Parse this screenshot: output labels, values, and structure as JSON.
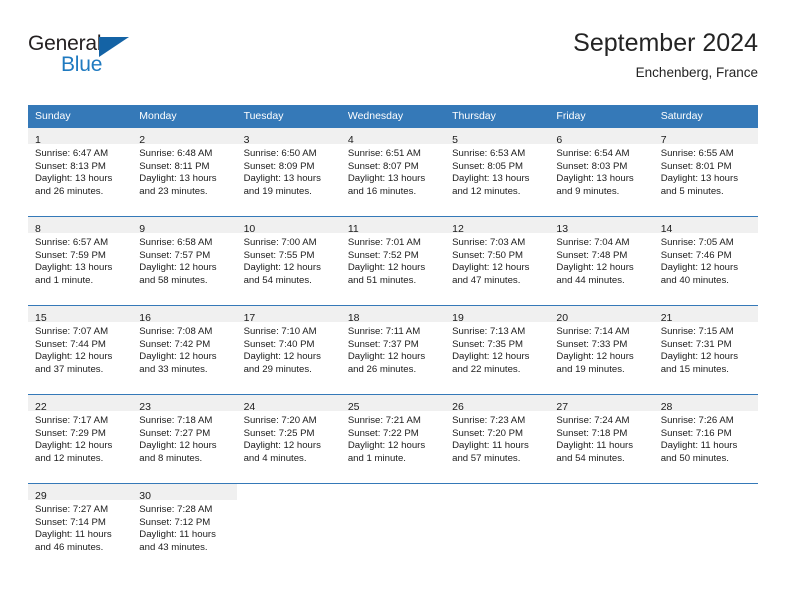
{
  "brand": {
    "name_part1": "General",
    "name_part2": "Blue",
    "triangle_color": "#1463a5",
    "blue_color": "#1f7ac0"
  },
  "header": {
    "title": "September 2024",
    "subtitle": "Enchenberg, France"
  },
  "theme": {
    "header_bg": "#3579b8",
    "daynum_band": "#f0f0f0",
    "row_border": "#3579b8"
  },
  "weekday_headers": [
    "Sunday",
    "Monday",
    "Tuesday",
    "Wednesday",
    "Thursday",
    "Friday",
    "Saturday"
  ],
  "weeks": [
    [
      {
        "day": "1",
        "sunrise": "Sunrise: 6:47 AM",
        "sunset": "Sunset: 8:13 PM",
        "daylight": "Daylight: 13 hours and 26 minutes."
      },
      {
        "day": "2",
        "sunrise": "Sunrise: 6:48 AM",
        "sunset": "Sunset: 8:11 PM",
        "daylight": "Daylight: 13 hours and 23 minutes."
      },
      {
        "day": "3",
        "sunrise": "Sunrise: 6:50 AM",
        "sunset": "Sunset: 8:09 PM",
        "daylight": "Daylight: 13 hours and 19 minutes."
      },
      {
        "day": "4",
        "sunrise": "Sunrise: 6:51 AM",
        "sunset": "Sunset: 8:07 PM",
        "daylight": "Daylight: 13 hours and 16 minutes."
      },
      {
        "day": "5",
        "sunrise": "Sunrise: 6:53 AM",
        "sunset": "Sunset: 8:05 PM",
        "daylight": "Daylight: 13 hours and 12 minutes."
      },
      {
        "day": "6",
        "sunrise": "Sunrise: 6:54 AM",
        "sunset": "Sunset: 8:03 PM",
        "daylight": "Daylight: 13 hours and 9 minutes."
      },
      {
        "day": "7",
        "sunrise": "Sunrise: 6:55 AM",
        "sunset": "Sunset: 8:01 PM",
        "daylight": "Daylight: 13 hours and 5 minutes."
      }
    ],
    [
      {
        "day": "8",
        "sunrise": "Sunrise: 6:57 AM",
        "sunset": "Sunset: 7:59 PM",
        "daylight": "Daylight: 13 hours and 1 minute."
      },
      {
        "day": "9",
        "sunrise": "Sunrise: 6:58 AM",
        "sunset": "Sunset: 7:57 PM",
        "daylight": "Daylight: 12 hours and 58 minutes."
      },
      {
        "day": "10",
        "sunrise": "Sunrise: 7:00 AM",
        "sunset": "Sunset: 7:55 PM",
        "daylight": "Daylight: 12 hours and 54 minutes."
      },
      {
        "day": "11",
        "sunrise": "Sunrise: 7:01 AM",
        "sunset": "Sunset: 7:52 PM",
        "daylight": "Daylight: 12 hours and 51 minutes."
      },
      {
        "day": "12",
        "sunrise": "Sunrise: 7:03 AM",
        "sunset": "Sunset: 7:50 PM",
        "daylight": "Daylight: 12 hours and 47 minutes."
      },
      {
        "day": "13",
        "sunrise": "Sunrise: 7:04 AM",
        "sunset": "Sunset: 7:48 PM",
        "daylight": "Daylight: 12 hours and 44 minutes."
      },
      {
        "day": "14",
        "sunrise": "Sunrise: 7:05 AM",
        "sunset": "Sunset: 7:46 PM",
        "daylight": "Daylight: 12 hours and 40 minutes."
      }
    ],
    [
      {
        "day": "15",
        "sunrise": "Sunrise: 7:07 AM",
        "sunset": "Sunset: 7:44 PM",
        "daylight": "Daylight: 12 hours and 37 minutes."
      },
      {
        "day": "16",
        "sunrise": "Sunrise: 7:08 AM",
        "sunset": "Sunset: 7:42 PM",
        "daylight": "Daylight: 12 hours and 33 minutes."
      },
      {
        "day": "17",
        "sunrise": "Sunrise: 7:10 AM",
        "sunset": "Sunset: 7:40 PM",
        "daylight": "Daylight: 12 hours and 29 minutes."
      },
      {
        "day": "18",
        "sunrise": "Sunrise: 7:11 AM",
        "sunset": "Sunset: 7:37 PM",
        "daylight": "Daylight: 12 hours and 26 minutes."
      },
      {
        "day": "19",
        "sunrise": "Sunrise: 7:13 AM",
        "sunset": "Sunset: 7:35 PM",
        "daylight": "Daylight: 12 hours and 22 minutes."
      },
      {
        "day": "20",
        "sunrise": "Sunrise: 7:14 AM",
        "sunset": "Sunset: 7:33 PM",
        "daylight": "Daylight: 12 hours and 19 minutes."
      },
      {
        "day": "21",
        "sunrise": "Sunrise: 7:15 AM",
        "sunset": "Sunset: 7:31 PM",
        "daylight": "Daylight: 12 hours and 15 minutes."
      }
    ],
    [
      {
        "day": "22",
        "sunrise": "Sunrise: 7:17 AM",
        "sunset": "Sunset: 7:29 PM",
        "daylight": "Daylight: 12 hours and 12 minutes."
      },
      {
        "day": "23",
        "sunrise": "Sunrise: 7:18 AM",
        "sunset": "Sunset: 7:27 PM",
        "daylight": "Daylight: 12 hours and 8 minutes."
      },
      {
        "day": "24",
        "sunrise": "Sunrise: 7:20 AM",
        "sunset": "Sunset: 7:25 PM",
        "daylight": "Daylight: 12 hours and 4 minutes."
      },
      {
        "day": "25",
        "sunrise": "Sunrise: 7:21 AM",
        "sunset": "Sunset: 7:22 PM",
        "daylight": "Daylight: 12 hours and 1 minute."
      },
      {
        "day": "26",
        "sunrise": "Sunrise: 7:23 AM",
        "sunset": "Sunset: 7:20 PM",
        "daylight": "Daylight: 11 hours and 57 minutes."
      },
      {
        "day": "27",
        "sunrise": "Sunrise: 7:24 AM",
        "sunset": "Sunset: 7:18 PM",
        "daylight": "Daylight: 11 hours and 54 minutes."
      },
      {
        "day": "28",
        "sunrise": "Sunrise: 7:26 AM",
        "sunset": "Sunset: 7:16 PM",
        "daylight": "Daylight: 11 hours and 50 minutes."
      }
    ],
    [
      {
        "day": "29",
        "sunrise": "Sunrise: 7:27 AM",
        "sunset": "Sunset: 7:14 PM",
        "daylight": "Daylight: 11 hours and 46 minutes."
      },
      {
        "day": "30",
        "sunrise": "Sunrise: 7:28 AM",
        "sunset": "Sunset: 7:12 PM",
        "daylight": "Daylight: 11 hours and 43 minutes."
      },
      {
        "day": "",
        "sunrise": "",
        "sunset": "",
        "daylight": ""
      },
      {
        "day": "",
        "sunrise": "",
        "sunset": "",
        "daylight": ""
      },
      {
        "day": "",
        "sunrise": "",
        "sunset": "",
        "daylight": ""
      },
      {
        "day": "",
        "sunrise": "",
        "sunset": "",
        "daylight": ""
      },
      {
        "day": "",
        "sunrise": "",
        "sunset": "",
        "daylight": ""
      }
    ]
  ]
}
